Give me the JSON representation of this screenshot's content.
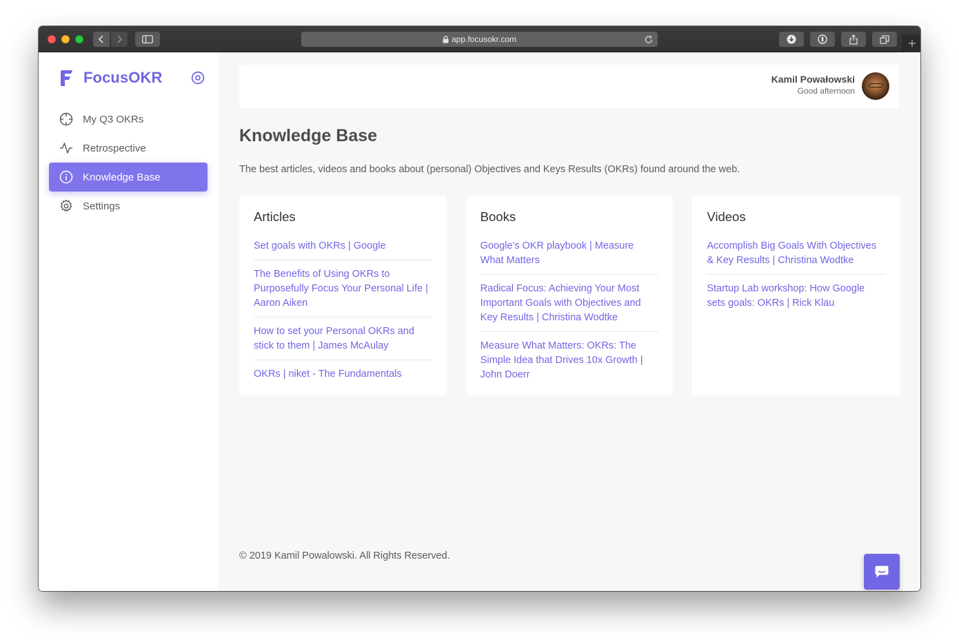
{
  "browser": {
    "url": "app.focusokr.com"
  },
  "sidebar": {
    "brand": "FocusOKR",
    "items": [
      {
        "label": "My Q3 OKRs",
        "icon": "crosshair-icon",
        "active": false
      },
      {
        "label": "Retrospective",
        "icon": "activity-icon",
        "active": false
      },
      {
        "label": "Knowledge Base",
        "icon": "info-icon",
        "active": true
      },
      {
        "label": "Settings",
        "icon": "gear-icon",
        "active": false
      }
    ]
  },
  "header": {
    "user_name": "Kamil Powałowski",
    "greeting": "Good afternoon"
  },
  "main": {
    "title": "Knowledge Base",
    "description": "The best articles, videos and books about (personal) Objectives and Keys Results (OKRs) found around the web.",
    "cards": [
      {
        "title": "Articles",
        "links": [
          "Set goals with OKRs | Google",
          "The Benefits of Using OKRs to Purposefully Focus Your Personal Life | Aaron Aiken",
          "How to set your Personal OKRs and stick to them | James McAulay",
          "OKRs | niket - The Fundamentals"
        ]
      },
      {
        "title": "Books",
        "links": [
          "Google's OKR playbook | Measure What Matters",
          "Radical Focus: Achieving Your Most Important Goals with Objectives and Key Results | Christina Wodtke",
          "Measure What Matters: OKRs: The Simple Idea that Drives 10x Growth | John Doerr"
        ]
      },
      {
        "title": "Videos",
        "links": [
          "Accomplish Big Goals With Objectives & Key Results | Christina Wodtke",
          "Startup Lab workshop: How Google sets goals: OKRs | Rick Klau"
        ]
      }
    ]
  },
  "footer": {
    "text": "© 2019 Kamil Powalowski. All Rights Reserved."
  },
  "colors": {
    "accent": "#7166e4",
    "active_nav": "#7f74ec",
    "background": "#f7f7f7"
  }
}
